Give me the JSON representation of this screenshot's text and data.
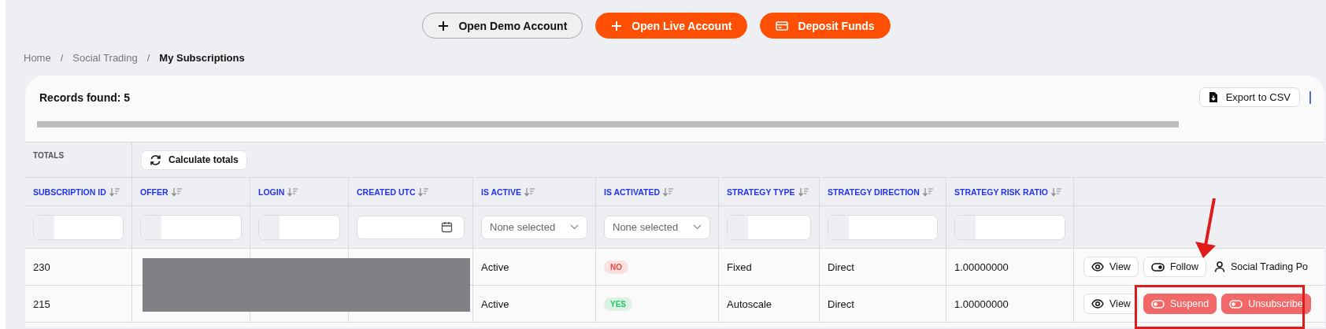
{
  "header_buttons": [
    {
      "label": "Open Demo Account",
      "kind": "outline"
    },
    {
      "label": "Open Live Account",
      "kind": "primary"
    },
    {
      "label": "Deposit Funds",
      "kind": "primary"
    }
  ],
  "breadcrumb": [
    {
      "label": "Home",
      "current": false
    },
    {
      "label": "Social Trading",
      "current": false,
      "separator": "/"
    },
    {
      "label": "My Subscriptions",
      "current": true,
      "separator": "/"
    }
  ],
  "grid": {
    "records_found": "Records found: 5",
    "export_button": "Export to CSV",
    "totals_label": "TOTALS",
    "calculate_button": "Calculate totals",
    "columns": [
      {
        "label": "SUBSCRIPTION ID",
        "kind": "text"
      },
      {
        "label": "OFFER",
        "kind": "text"
      },
      {
        "label": "LOGIN",
        "kind": "text"
      },
      {
        "label": "CREATED UTC",
        "kind": "date"
      },
      {
        "label": "IS ACTIVE",
        "kind": "select",
        "placeholder": "None selected"
      },
      {
        "label": "IS ACTIVATED",
        "kind": "select",
        "placeholder": "None selected"
      },
      {
        "label": "STRATEGY TYPE",
        "kind": "text"
      },
      {
        "label": "STRATEGY DIRECTION",
        "kind": "text"
      },
      {
        "label": "STRATEGY RISK RATIO",
        "kind": "text"
      }
    ],
    "rows": [
      {
        "subscription_id": "230",
        "is_active": "Active",
        "is_activated": {
          "text": "NO",
          "color": "#ef4444"
        },
        "strategy_type": "Fixed",
        "strategy_direction": "Direct",
        "strategy_risk_ratio": "1.00000000",
        "actions": [
          {
            "label": "View",
            "kind": "view"
          },
          {
            "label": "Follow",
            "kind": "toggle"
          },
          {
            "label": "Social Trading Po",
            "kind": "portal"
          }
        ]
      },
      {
        "subscription_id": "215",
        "is_active": "Active",
        "is_activated": {
          "text": "YES",
          "color": "#22c55e"
        },
        "strategy_type": "Autoscale",
        "strategy_direction": "Direct",
        "strategy_risk_ratio": "1.00000000",
        "actions": [
          {
            "label": "View",
            "kind": "view"
          },
          {
            "label": "Suspend",
            "kind": "danger"
          },
          {
            "label": "Unsubscribe",
            "kind": "danger"
          }
        ]
      }
    ]
  }
}
